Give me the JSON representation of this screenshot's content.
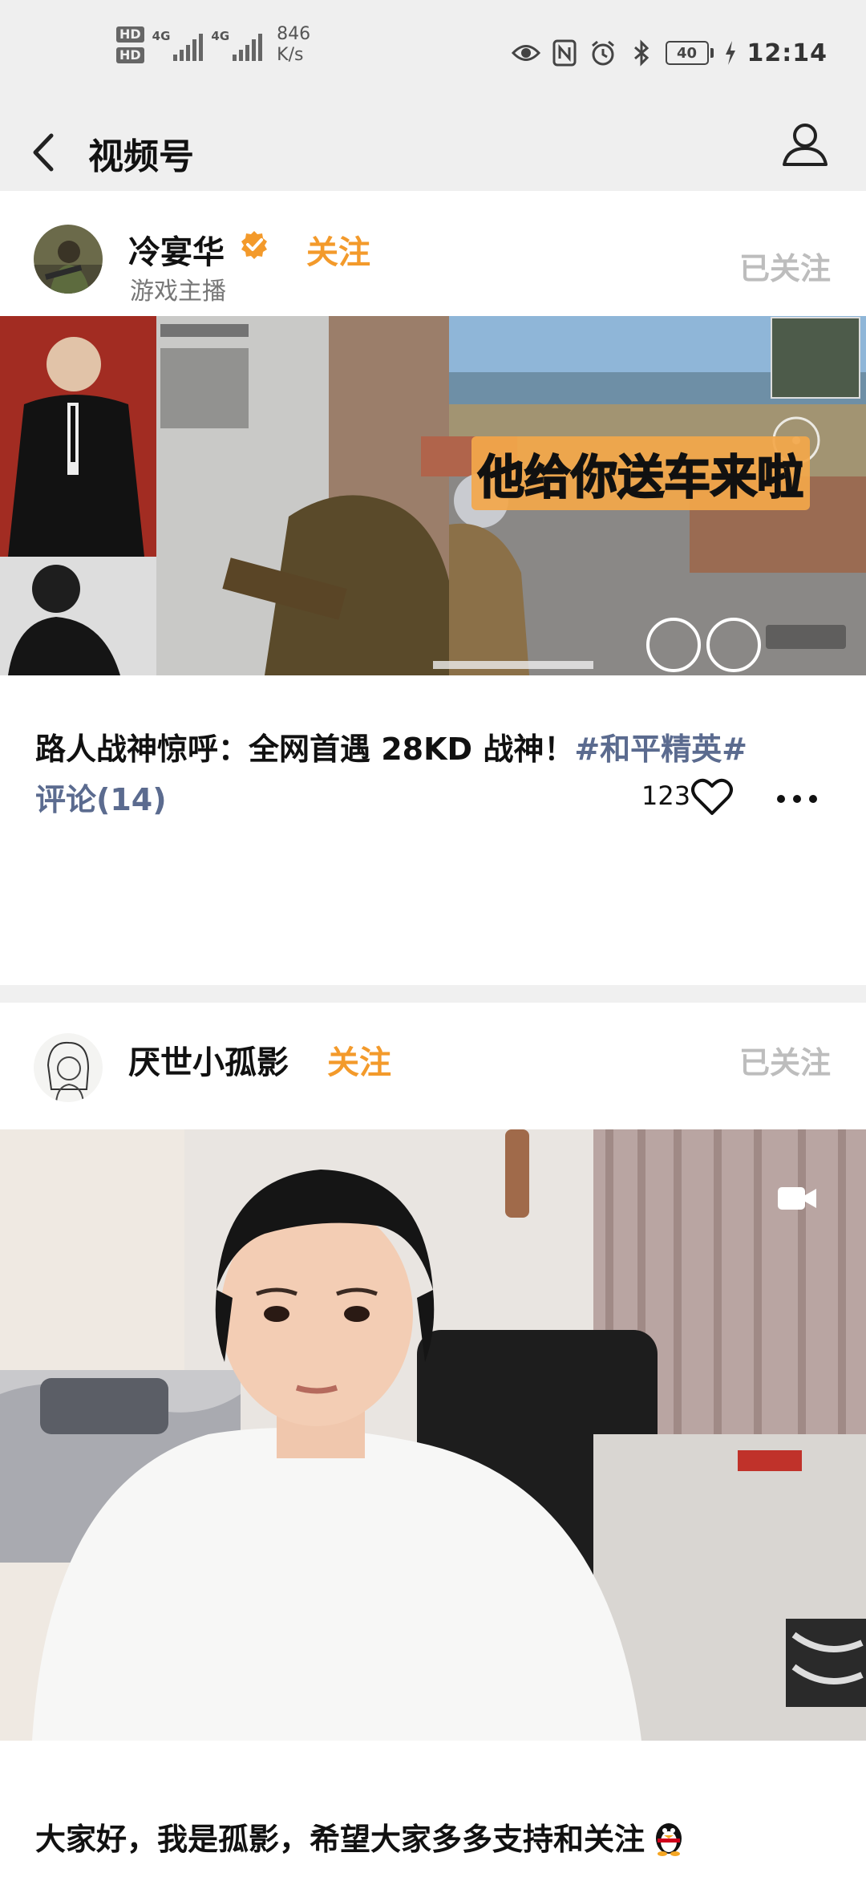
{
  "status_bar": {
    "hd1": "HD",
    "hd2": "HD",
    "sim1_label": "4G",
    "sim2_label": "4G",
    "speed_value": "846",
    "speed_unit": "K/s",
    "battery_level": "40",
    "time": "12:14",
    "icons": [
      "eye-comfort-icon",
      "nfc-icon",
      "alarm-icon",
      "bluetooth-icon",
      "battery-icon",
      "charging-icon"
    ]
  },
  "nav": {
    "title": "视频号"
  },
  "posts": [
    {
      "author": "冷宴华",
      "verified": true,
      "follow_label": "关注",
      "subtitle": "游戏主播",
      "followed_label": "已关注",
      "overlay_text": "他给你送车来啦",
      "caption": "路人战神惊呼：全网首遇 28KD 战神！",
      "hashtag": "#和平精英#",
      "comments_label": "评论(14)",
      "likes": "123"
    },
    {
      "author": "厌世小孤影",
      "follow_label": "关注",
      "followed_label": "已关注",
      "caption": "大家好，我是孤影，希望大家多多支持和关注"
    }
  ],
  "colors": {
    "accent_orange": "#f39a2b",
    "link_blue_gray": "#5b6b8f",
    "muted_gray": "#bdbdbd",
    "bar_bg": "#efefef"
  }
}
